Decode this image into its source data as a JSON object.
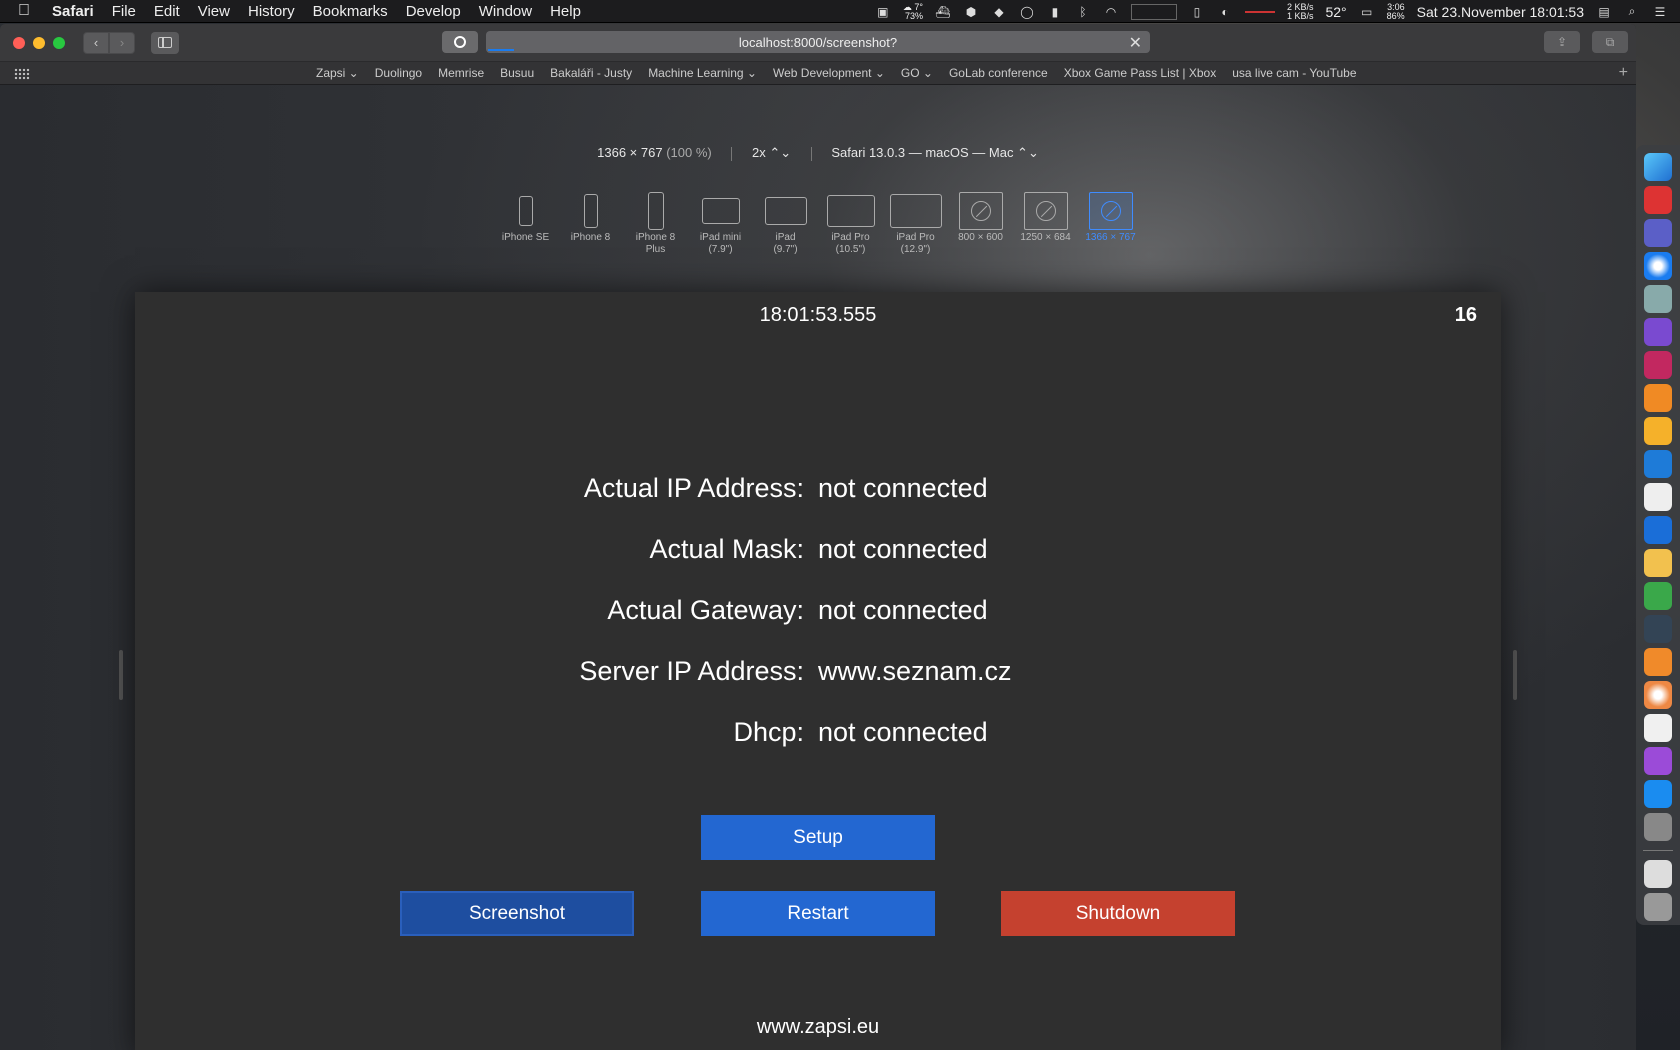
{
  "menubar": {
    "app": "Safari",
    "menus": [
      "File",
      "Edit",
      "View",
      "History",
      "Bookmarks",
      "Develop",
      "Window",
      "Help"
    ],
    "weather": "7°\n73%",
    "net_up": "2 KB/s",
    "net_down": "1 KB/s",
    "temp": "52°",
    "battery_time": "3:06",
    "battery_pct": "86%",
    "datetime": "Sat 23.November 18:01:53"
  },
  "browser": {
    "url": "localhost:8000/screenshot?",
    "favorites": [
      "Zapsi ⌄",
      "Duolingo",
      "Memrise",
      "Busuu",
      "Bakaláři - Justy",
      "Machine Learning ⌄",
      "Web Development ⌄",
      "GO ⌄",
      "GoLab conference",
      "Xbox Game Pass List | Xbox",
      "usa live cam - YouTube"
    ]
  },
  "rdm": {
    "size": "1366 × 767",
    "zoom": "(100 %)",
    "scale": "2x ⌃⌄",
    "agent": "Safari 13.0.3 — macOS — Mac ⌃⌄",
    "devices": [
      {
        "label": "iPhone SE",
        "sub": ""
      },
      {
        "label": "iPhone 8",
        "sub": ""
      },
      {
        "label": "iPhone 8",
        "sub": "Plus"
      },
      {
        "label": "iPad mini",
        "sub": "(7.9\")"
      },
      {
        "label": "iPad",
        "sub": "(9.7\")"
      },
      {
        "label": "iPad Pro",
        "sub": "(10.5\")"
      },
      {
        "label": "iPad Pro",
        "sub": "(12.9\")"
      },
      {
        "label": "800 × 600",
        "sub": ""
      },
      {
        "label": "1250 × 684",
        "sub": ""
      },
      {
        "label": "1366 × 767",
        "sub": ""
      }
    ]
  },
  "page": {
    "time": "18:01:53.555",
    "count": "16",
    "rows": [
      {
        "label": "Actual IP Address:",
        "value": "not connected"
      },
      {
        "label": "Actual Mask:",
        "value": "not connected"
      },
      {
        "label": "Actual Gateway:",
        "value": "not connected"
      },
      {
        "label": "Server IP Address:",
        "value": "www.seznam.cz"
      },
      {
        "label": "Dhcp:",
        "value": "not connected"
      }
    ],
    "buttons": {
      "setup": "Setup",
      "screenshot": "Screenshot",
      "restart": "Restart",
      "shutdown": "Shutdown"
    },
    "footer": "www.zapsi.eu"
  },
  "colors": {
    "blue_button": "#2367d1",
    "active_button": "#1e4ea0",
    "red_button": "#c5412f"
  }
}
